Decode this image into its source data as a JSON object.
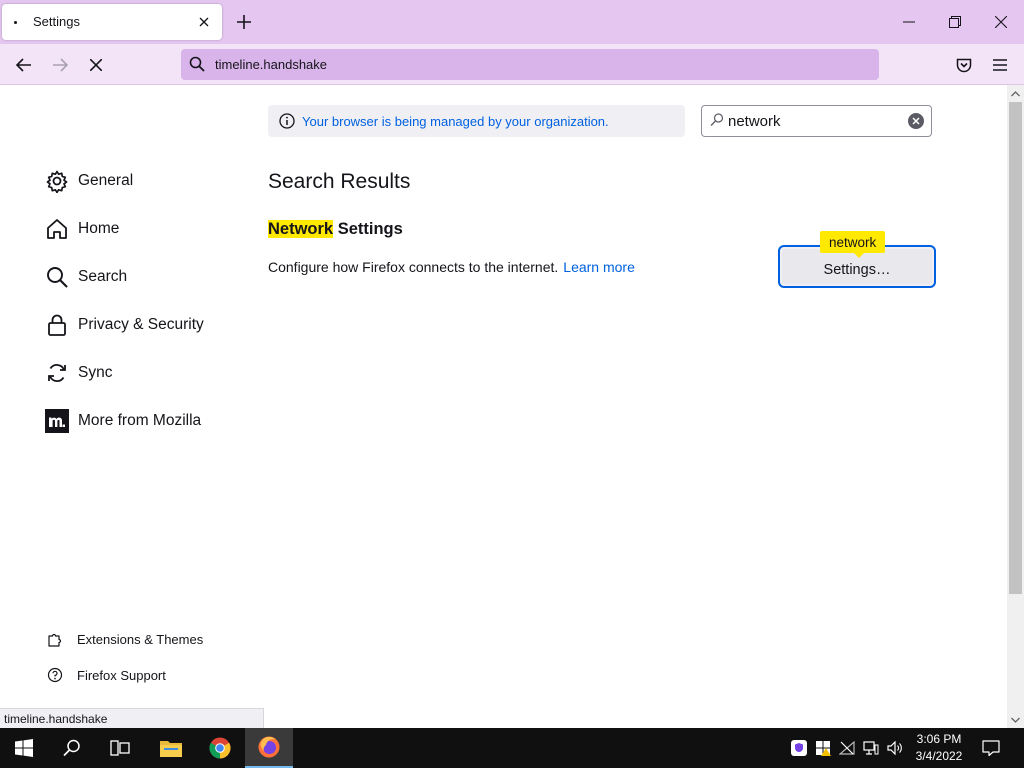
{
  "browser": {
    "tab_title": "Settings",
    "url": "timeline.handshake",
    "status_text": "timeline.handshake"
  },
  "sidebar": {
    "items": [
      {
        "label": "General",
        "icon": "gear-icon"
      },
      {
        "label": "Home",
        "icon": "home-icon"
      },
      {
        "label": "Search",
        "icon": "search-icon"
      },
      {
        "label": "Privacy & Security",
        "icon": "lock-icon"
      },
      {
        "label": "Sync",
        "icon": "sync-icon"
      },
      {
        "label": "More from Mozilla",
        "icon": "mozilla-icon"
      }
    ],
    "footer": [
      {
        "label": "Extensions & Themes",
        "icon": "puzzle-icon"
      },
      {
        "label": "Firefox Support",
        "icon": "help-icon"
      }
    ]
  },
  "policy_notice": "Your browser is being managed by your organization.",
  "search": {
    "value": "network"
  },
  "results": {
    "title": "Search Results",
    "heading_highlight": "Network",
    "heading_rest": " Settings",
    "description": "Configure how Firefox connects to the internet.",
    "learn_more": "Learn more",
    "settings_button": "Settings…",
    "tooltip": "network"
  },
  "taskbar": {
    "time": "3:06 PM",
    "date": "3/4/2022"
  },
  "colors": {
    "accent": "#0061e0",
    "highlight": "#ffe900",
    "titlebar": "#e4c6f0"
  }
}
